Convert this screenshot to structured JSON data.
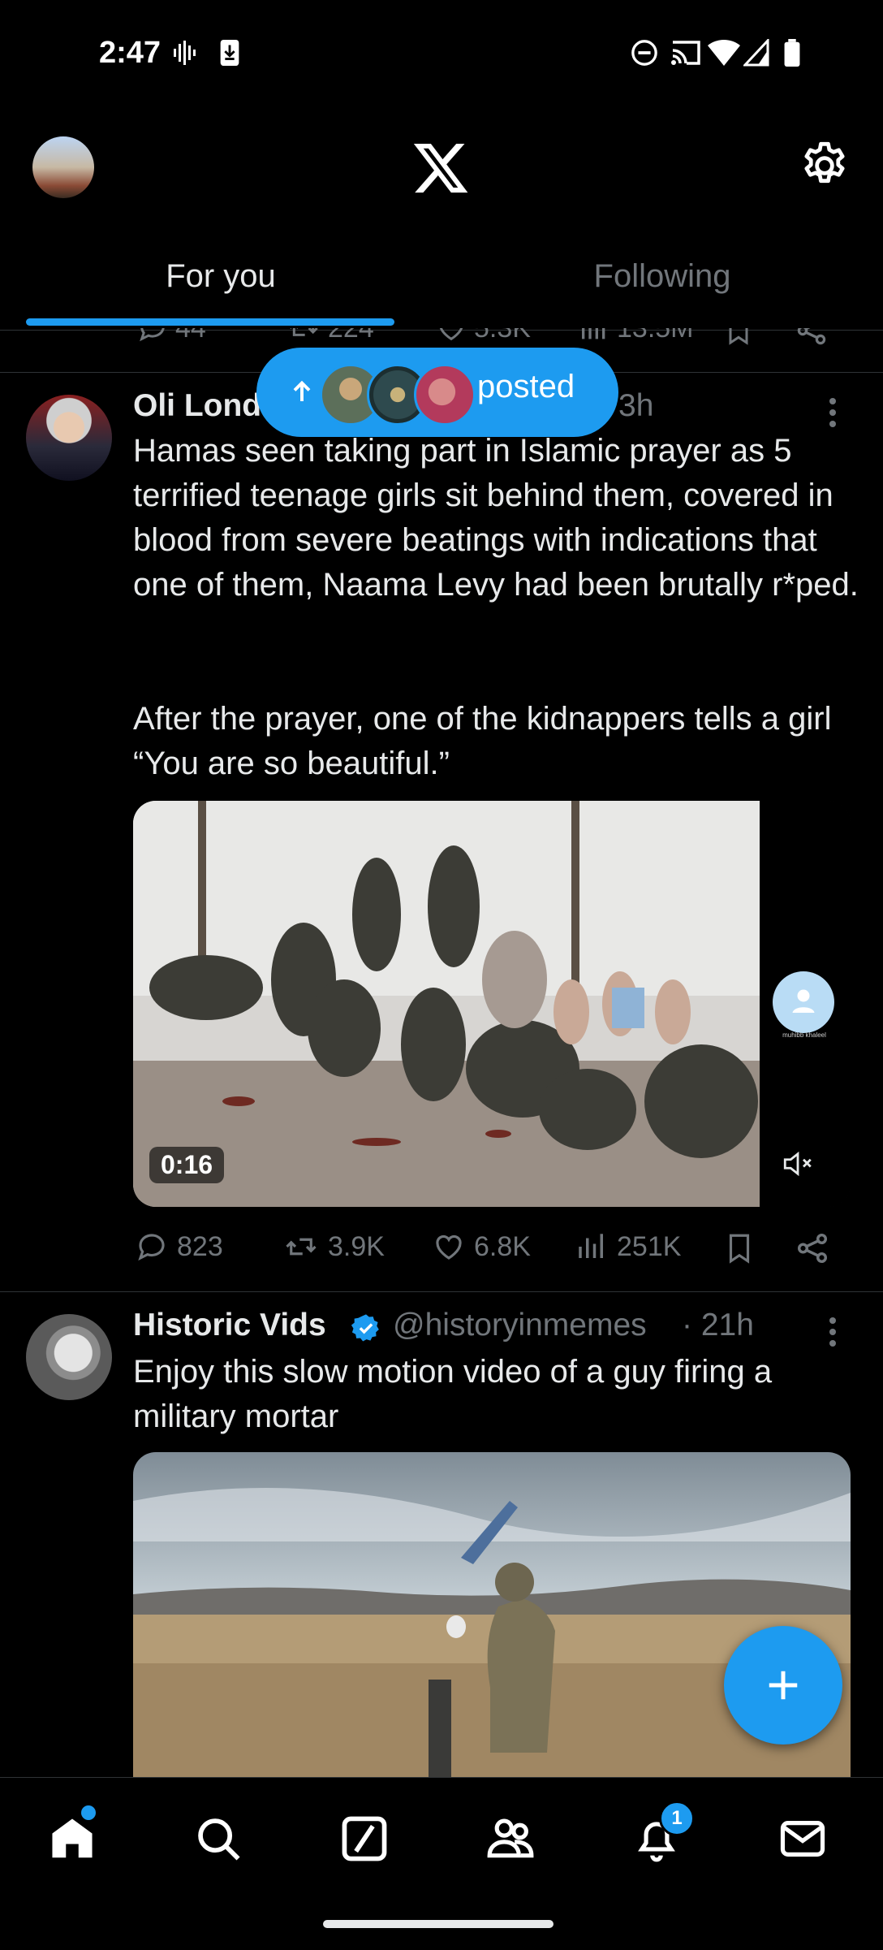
{
  "status_bar": {
    "time": "2:47"
  },
  "header": {
    "tabs": [
      "For you",
      "Following"
    ],
    "active_tab": "For you"
  },
  "prev_post_actions": {
    "replies": "44",
    "reposts": "224",
    "likes": "5.3K",
    "views": "13.5M"
  },
  "new_posts_pill": {
    "label": "posted"
  },
  "posts": [
    {
      "name": "Oli Lond",
      "time": "3h",
      "text_p1": "Hamas seen taking part in Islamic prayer as 5 terrified teenage girls sit behind them, covered in blood from severe beatings with indications that one of them, Naama Levy had been brutally r*ped.",
      "text_p2": "After the prayer, one of the kidnappers tells a girl “You are so beautiful.”",
      "video_duration": "0:16",
      "replies": "823",
      "reposts": "3.9K",
      "likes": "6.8K",
      "views": "251K"
    },
    {
      "name": "Historic Vids",
      "handle": "@historyinmemes",
      "time": "· 21h",
      "text": "Enjoy this slow motion video of a guy firing a military mortar"
    }
  ],
  "floating_profile_caption": "muhibb khaleel",
  "nav": {
    "notifications_badge": "1"
  },
  "colors": {
    "accent": "#1d9bf0",
    "background": "#000000",
    "secondary_text": "#71767b"
  }
}
